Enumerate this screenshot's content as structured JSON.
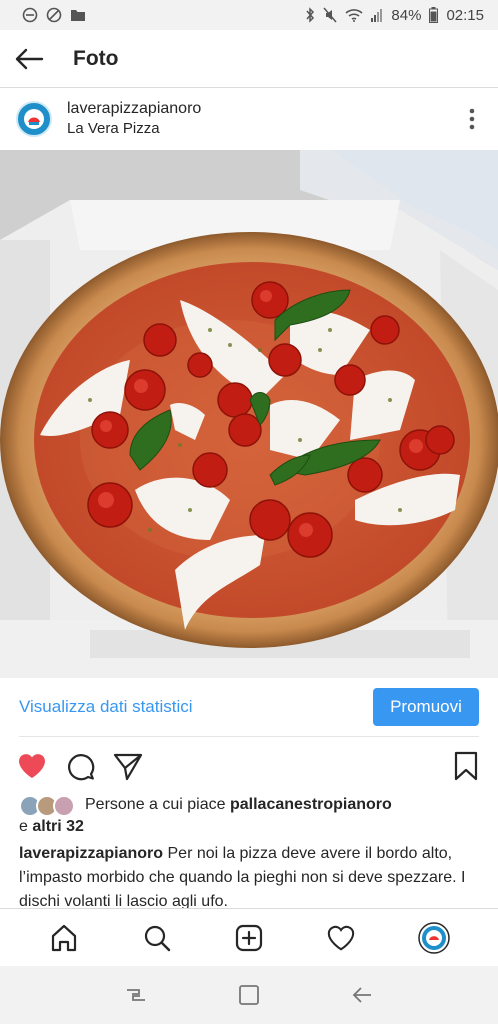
{
  "status_bar": {
    "battery": "84%",
    "time": "02:15"
  },
  "header": {
    "title": "Foto"
  },
  "post": {
    "username": "laverapizzapianoro",
    "location": "La Vera Pizza",
    "image_alt": "Pizza margherita with mozzarella, cherry tomatoes and basil in a box"
  },
  "insights": {
    "view_stats_label": "Visualizza dati statistici",
    "promote_label": "Promuovi"
  },
  "likes": {
    "prefix": "Persone a cui piace ",
    "first_liker": "pallacanestropianoro",
    "conjunction": "e ",
    "others": "altri 32"
  },
  "caption": {
    "username": "laverapizzapianoro",
    "text": " Per noi la pizza deve avere il bordo alto, l’impasto morbido che quando la pieghi non si deve spezzare. I dischi volanti li lascio agli ufo."
  },
  "colors": {
    "accent": "#3897f0",
    "like_red": "#ed4956"
  },
  "icons": {
    "nav": [
      "home-icon",
      "search-icon",
      "add-post-icon",
      "activity-heart-icon",
      "profile-avatar-icon"
    ],
    "actions": [
      "heart-filled-icon",
      "comment-icon",
      "share-icon",
      "bookmark-icon"
    ]
  }
}
